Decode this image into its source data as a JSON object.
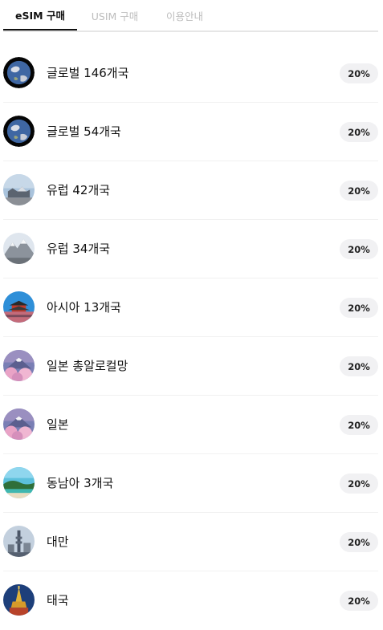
{
  "tabs": [
    {
      "label": "eSIM 구매",
      "active": true
    },
    {
      "label": "USIM 구매",
      "active": false
    },
    {
      "label": "이용안내",
      "active": false
    }
  ],
  "products": [
    {
      "name": "글로벌 146개국",
      "discount": "20%",
      "icon": "earth-globe-icon"
    },
    {
      "name": "글로벌 54개국",
      "discount": "20%",
      "icon": "earth-globe-icon"
    },
    {
      "name": "유럽 42개국",
      "discount": "20%",
      "icon": "europe-landmark-icon"
    },
    {
      "name": "유럽 34개국",
      "discount": "20%",
      "icon": "europe-mountain-icon"
    },
    {
      "name": "아시아 13개국",
      "discount": "20%",
      "icon": "asia-palace-icon"
    },
    {
      "name": "일본 총알로컬망",
      "discount": "20%",
      "icon": "japan-mountain-icon"
    },
    {
      "name": "일본",
      "discount": "20%",
      "icon": "japan-mountain-icon"
    },
    {
      "name": "동남아 3개국",
      "discount": "20%",
      "icon": "tropical-beach-icon"
    },
    {
      "name": "대만",
      "discount": "20%",
      "icon": "taipei-skyline-icon"
    },
    {
      "name": "태국",
      "discount": "20%",
      "icon": "thai-temple-icon"
    }
  ],
  "colors": {
    "active_tab": "#111111",
    "inactive_tab": "#bdbdbd",
    "badge_bg": "#f1f1f3",
    "divider": "#f1f1f1"
  }
}
